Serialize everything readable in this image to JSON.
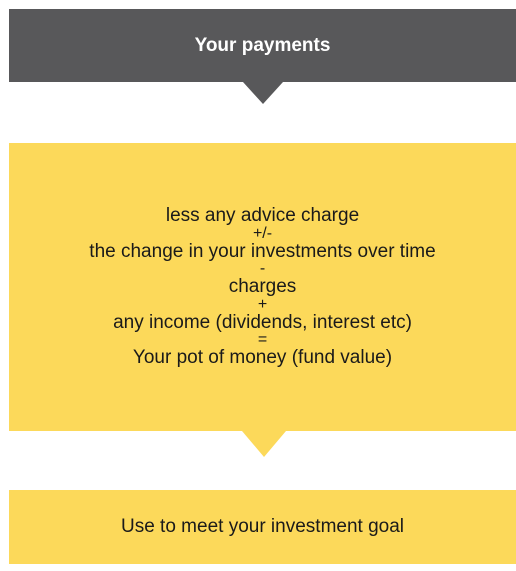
{
  "top_box": {
    "label": "Your payments"
  },
  "middle_box": {
    "lines": [
      "less any advice charge",
      "+/-",
      "the change in your investments over time",
      "-",
      "charges",
      "+",
      "any income (dividends, interest etc)",
      "=",
      "Your pot of money (fund value)"
    ]
  },
  "bottom_box": {
    "label": "Use to meet your investment goal"
  },
  "colors": {
    "dark_box": "#58585a",
    "yellow_box": "#fcd95a"
  }
}
